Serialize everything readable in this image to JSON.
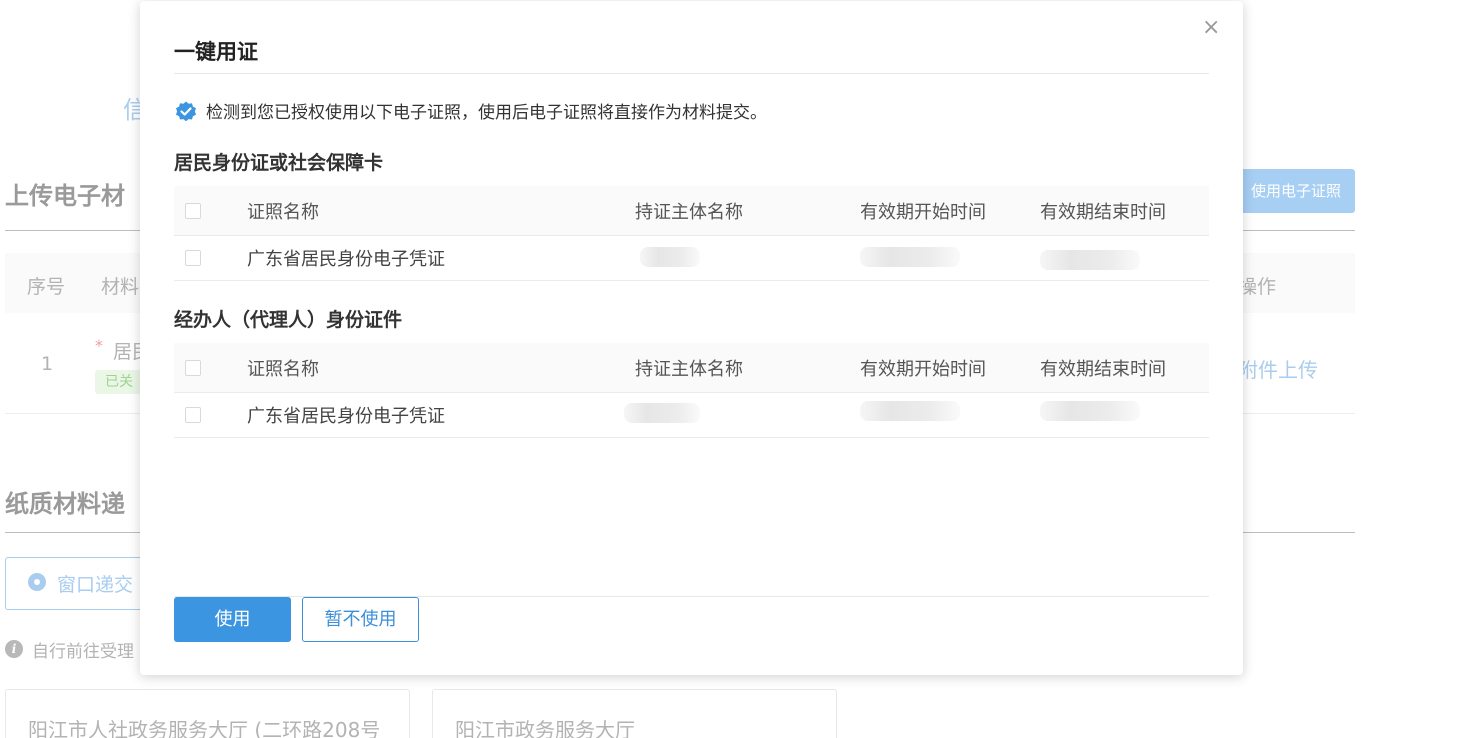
{
  "background": {
    "letter_top": "信",
    "upload_section_title": "上传电子材",
    "use_cert_button": "使用电子证照",
    "table_headers": {
      "index": "序号",
      "material": "材料",
      "action": "操作"
    },
    "row": {
      "index": "1",
      "required_mark": "*",
      "name": "居民",
      "tag": "已关",
      "action": "附件上传"
    },
    "paper_section_title": "纸质材料递",
    "radio_label": "窗口递交",
    "hint": "自行前往受理",
    "cards": [
      "阳江市人社政务服务大厅 (二环路208号",
      "阳江市政务服务大厅"
    ]
  },
  "modal": {
    "title": "一键用证",
    "close_symbol": "×",
    "notice": "检测到您已授权使用以下电子证照，使用后电子证照将直接作为材料提交。",
    "columns": [
      "证照名称",
      "持证主体名称",
      "有效期开始时间",
      "有效期结束时间"
    ],
    "sections": [
      {
        "title": "居民身份证或社会保障卡",
        "rows": [
          {
            "name": "广东省居民身份电子凭证"
          }
        ]
      },
      {
        "title": "经办人（代理人）身份证件",
        "rows": [
          {
            "name": "广东省居民身份电子凭证"
          }
        ]
      }
    ],
    "buttons": {
      "use": "使用",
      "skip": "暂不使用"
    },
    "colors": {
      "primary": "#3c95e0",
      "badge": "#3c95e0"
    }
  }
}
